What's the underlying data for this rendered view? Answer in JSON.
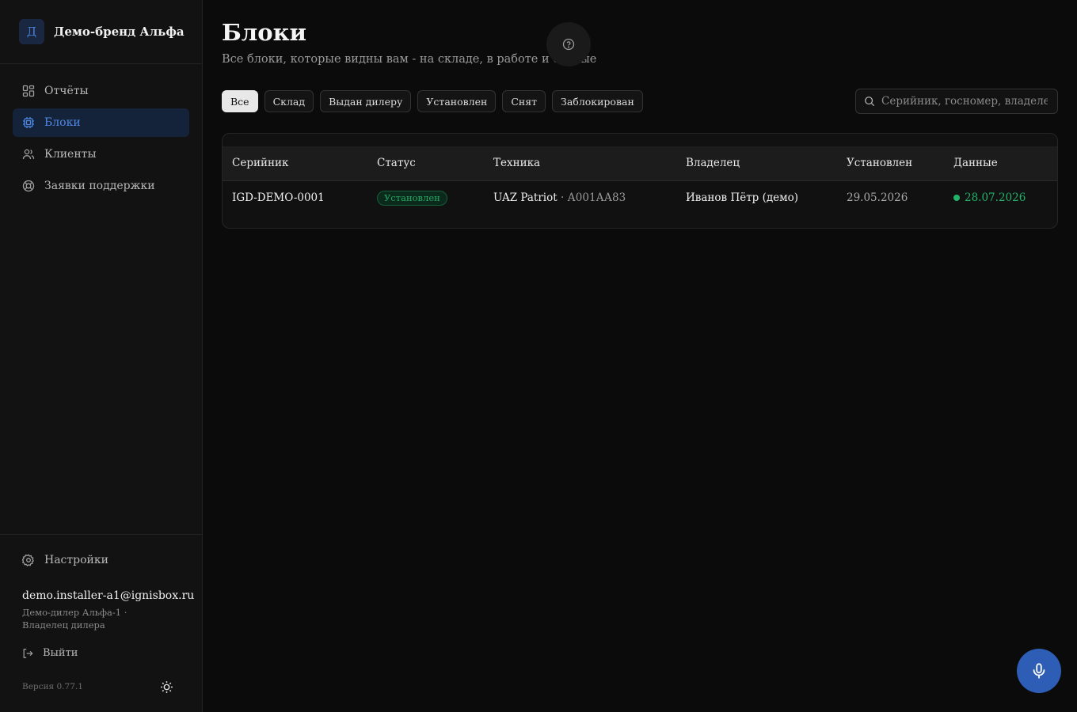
{
  "brand": {
    "logo_letter": "Д",
    "name": "Демо-бренд Альфа"
  },
  "sidebar": {
    "items": [
      {
        "label": "Отчёты",
        "icon": "dashboard-icon"
      },
      {
        "label": "Блоки",
        "icon": "chip-icon",
        "active": true
      },
      {
        "label": "Клиенты",
        "icon": "users-icon"
      },
      {
        "label": "Заявки поддержки",
        "icon": "lifebuoy-icon"
      }
    ],
    "settings_label": "Настройки",
    "user_email": "demo.installer-a1@ignisbox.ru",
    "user_role": "Демо-дилер Альфа-1 · Владелец дилера",
    "logout_label": "Выйти",
    "version": "Версия 0.77.1"
  },
  "header": {
    "title": "Блоки",
    "subtitle": "Все блоки, которые видны вам - на складе, в работе и снятые"
  },
  "filters": [
    "Все",
    "Склад",
    "Выдан дилеру",
    "Установлен",
    "Снят",
    "Заблокирован"
  ],
  "active_filter": "Все",
  "search": {
    "placeholder": "Серийник, госномер, владелец",
    "value": ""
  },
  "table": {
    "columns": [
      "Серийник",
      "Статус",
      "Техника",
      "Владелец",
      "Установлен",
      "Данные"
    ],
    "rows": [
      {
        "serial": "IGD-DEMO-0001",
        "status": "Установлен",
        "vehicle": "UAZ Patriot",
        "plate": "· А001АА83",
        "owner": "Иванов Пётр (демо)",
        "installed": "29.05.2026",
        "data": "28.07.2026"
      }
    ]
  },
  "colors": {
    "accent": "#4e8ae8",
    "status_ok": "#23b26b",
    "mic_button": "#2d5db4"
  }
}
